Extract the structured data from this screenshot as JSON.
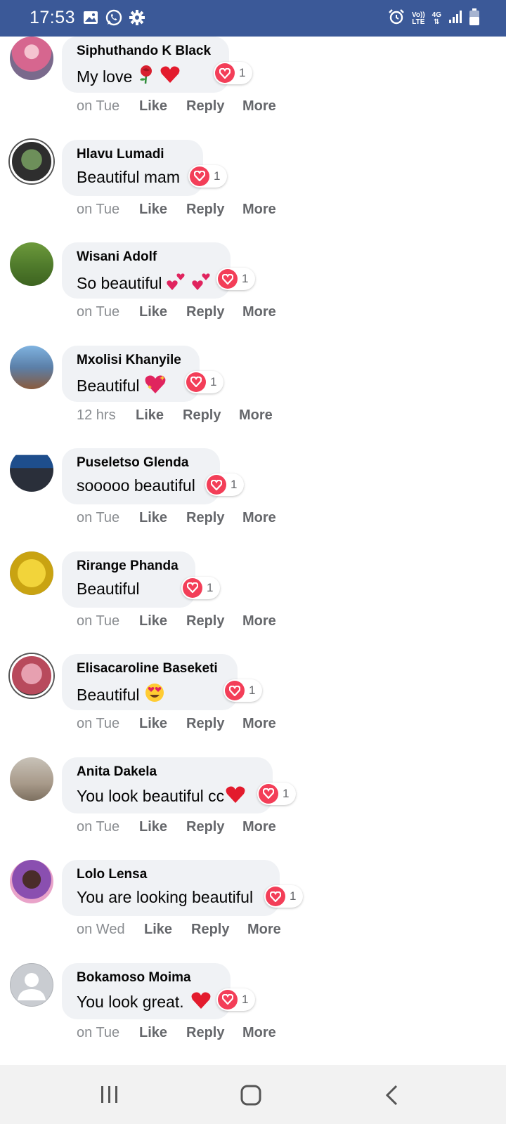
{
  "status_bar": {
    "time": "17:53",
    "left_icons": [
      "gallery-icon",
      "whatsapp-icon",
      "settings-icon"
    ],
    "right_icons": [
      "alarm-icon",
      "volte-icon",
      "4g-icon",
      "signal-icon",
      "battery-icon"
    ],
    "network_top": "Vo))",
    "network_bottom": "LTE",
    "net_type": "4G",
    "background": "#3b5998"
  },
  "comments": [
    {
      "author": "Siphuthando K Black",
      "text": "My love",
      "emojis": "rose-heart",
      "time": "on Tue",
      "reaction_count": "1",
      "avatar_color": "#d6668f"
    },
    {
      "author": "Hlavu Lumadi",
      "text": "Beautiful mam",
      "emojis": "",
      "time": "on Tue",
      "reaction_count": "1",
      "avatar_color": "#5a7d4a"
    },
    {
      "author": "Wisani Adolf",
      "text": "So beautiful",
      "emojis": "two-hearts",
      "time": "on Tue",
      "reaction_count": "1",
      "avatar_color": "#4f7a2b"
    },
    {
      "author": "Mxolisi Khanyile",
      "text": "Beautiful",
      "emojis": "sparkling-heart",
      "time": "12 hrs",
      "reaction_count": "1",
      "avatar_color": "#5b7fa8"
    },
    {
      "author": "Puseletso Glenda",
      "text": "sooooo beautiful",
      "emojis": "",
      "time": "on Tue",
      "reaction_count": "1",
      "avatar_color": "#1e4e8c"
    },
    {
      "author": "Rirange Phanda",
      "text": "Beautiful",
      "emojis": "",
      "time": "on Tue",
      "reaction_count": "1",
      "avatar_color": "#d9b91f"
    },
    {
      "author": "Elisacaroline Baseketi",
      "text": "Beautiful",
      "emojis": "heart-eyes",
      "time": "on Tue",
      "reaction_count": "1",
      "avatar_color": "#b84a5c"
    },
    {
      "author": "Anita Dakela",
      "text": "You look beautiful cc",
      "emojis": "heart",
      "time": "on Tue",
      "reaction_count": "1",
      "avatar_color": "#a89a8a"
    },
    {
      "author": "Lolo Lensa",
      "text": "You are looking beautiful",
      "emojis": "",
      "time": "on Wed",
      "reaction_count": "1",
      "avatar_color": "#8a4fb0"
    },
    {
      "author": "Bokamoso Moima",
      "text": "You look great.",
      "emojis": "heart",
      "time": "on Tue",
      "reaction_count": "1",
      "avatar_color": "#c9ccd1"
    }
  ],
  "actions": {
    "like": "Like",
    "reply": "Reply",
    "more": "More"
  },
  "nav_bar": {
    "buttons": [
      "recents-icon",
      "home-icon",
      "back-icon"
    ]
  }
}
